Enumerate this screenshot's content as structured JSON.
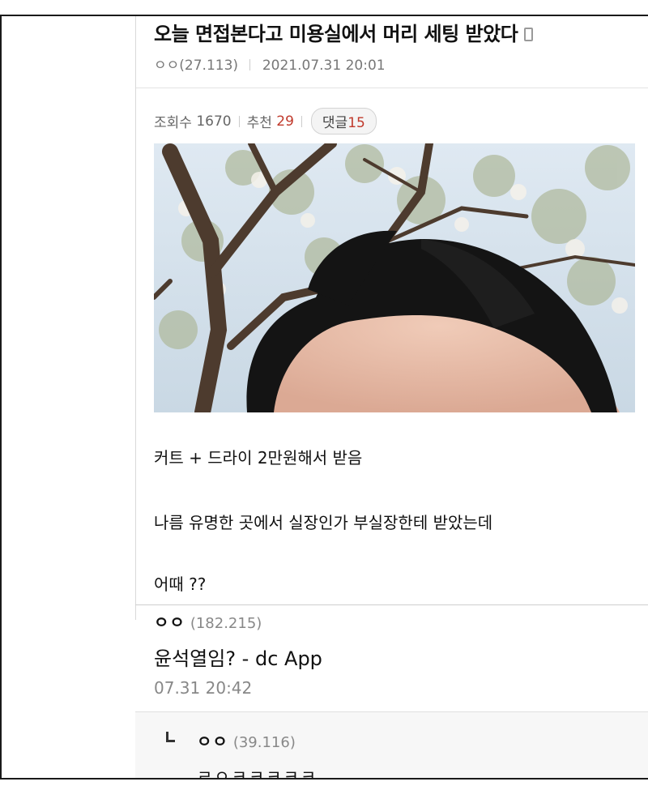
{
  "post": {
    "title": "오늘 면접본다고 미용실에서 머리 세팅 받았다",
    "author": "ㅇㅇ",
    "author_ip": "(27.113)",
    "datetime": "2021.07.31 20:01",
    "device_icon": "mobile-phone-icon",
    "views_label": "조회수",
    "views": "1670",
    "recommend_label": "추천",
    "recommend": "29",
    "comments_label": "댓글",
    "comments": "15",
    "image_alt": "photo",
    "body": [
      "커트 + 드라이 2만원해서 받음",
      "나름 유명한 곳에서 실장인가 부실장한테 받았는데",
      "어때 ??"
    ]
  },
  "comments": [
    {
      "nick": "ㅇㅇ",
      "ip": "(182.215)",
      "text": "윤석열임? - dc App",
      "date": "07.31 20:42"
    }
  ],
  "replies": [
    {
      "nick": "ㅇㅇ",
      "ip": "(39.116)",
      "text": "ㄹㅇㅋㅋㅋㅋㅋ"
    }
  ],
  "colors": {
    "accent_red": "#c0392b",
    "meta_gray": "#777777"
  }
}
